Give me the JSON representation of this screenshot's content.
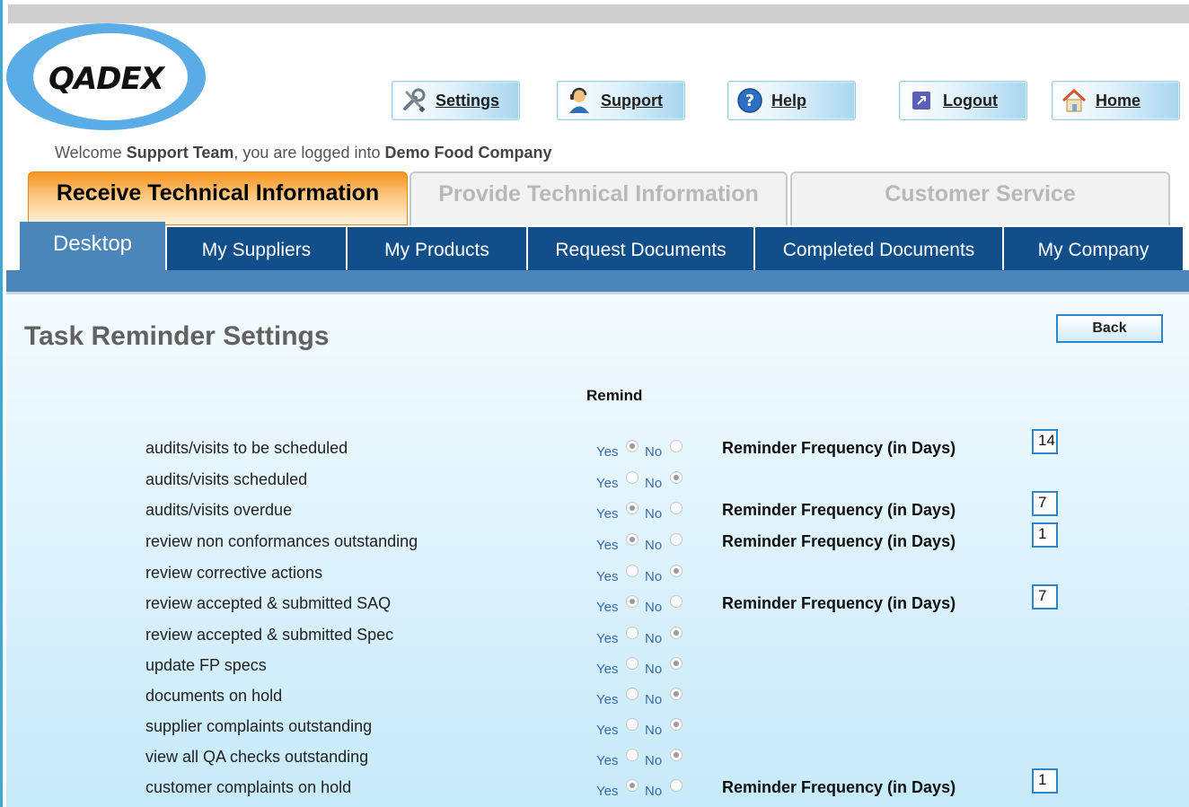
{
  "logo": {
    "text": "QADEX"
  },
  "nav": [
    {
      "label": "Settings",
      "icon": "tools-icon"
    },
    {
      "label": "Support",
      "icon": "support-agent-icon"
    },
    {
      "label": "Help",
      "icon": "help-icon"
    },
    {
      "label": "Logout",
      "icon": "logout-icon"
    },
    {
      "label": "Home",
      "icon": "home-icon"
    }
  ],
  "welcome": {
    "prefix": "Welcome ",
    "user": "Support Team",
    "middle": ", you are logged into ",
    "company": "Demo Food Company"
  },
  "main_tabs": [
    {
      "label": "Receive Technical Information",
      "active": true
    },
    {
      "label": "Provide Technical Information",
      "active": false
    },
    {
      "label": "Customer Service",
      "active": false
    }
  ],
  "sub_tabs": [
    {
      "label": "Desktop",
      "active": true
    },
    {
      "label": "My Suppliers"
    },
    {
      "label": "My Products"
    },
    {
      "label": "Request Documents"
    },
    {
      "label": "Completed Documents"
    },
    {
      "label": "My Company"
    }
  ],
  "page": {
    "title": "Task Reminder Settings",
    "back_label": "Back",
    "remind_header": "Remind",
    "yes_label": "Yes",
    "no_label": "No",
    "freq_label": "Reminder Frequency (in Days)"
  },
  "tasks": [
    {
      "label": "audits/visits to be scheduled",
      "remind": "yes",
      "frequency": "14"
    },
    {
      "label": "audits/visits scheduled",
      "remind": "no",
      "frequency": null
    },
    {
      "label": "audits/visits overdue",
      "remind": "yes",
      "frequency": "7"
    },
    {
      "label": "review non conformances outstanding",
      "remind": "yes",
      "frequency": "1"
    },
    {
      "label": "review corrective actions",
      "remind": "no",
      "frequency": null
    },
    {
      "label": "review accepted & submitted SAQ",
      "remind": "yes",
      "frequency": "7"
    },
    {
      "label": "review accepted & submitted Spec",
      "remind": "no",
      "frequency": null
    },
    {
      "label": "update FP specs",
      "remind": "no",
      "frequency": null
    },
    {
      "label": "documents on hold",
      "remind": "no",
      "frequency": null
    },
    {
      "label": "supplier complaints outstanding",
      "remind": "no",
      "frequency": null
    },
    {
      "label": "view all QA checks outstanding",
      "remind": "no",
      "frequency": null
    },
    {
      "label": "customer complaints on hold",
      "remind": "yes",
      "frequency": "1"
    }
  ]
}
